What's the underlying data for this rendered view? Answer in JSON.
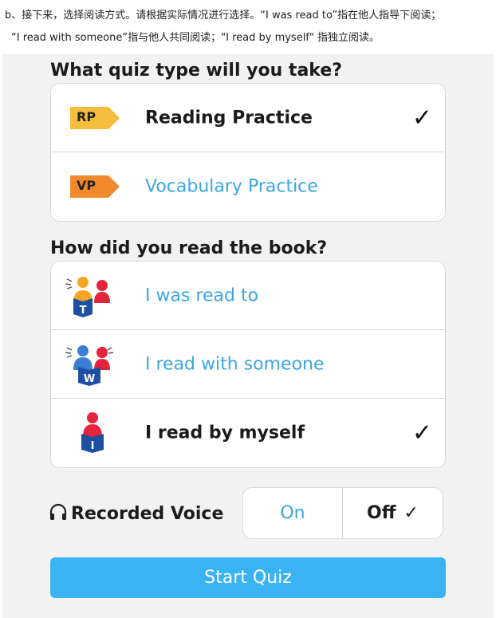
{
  "intro": {
    "line1": "b、接下来，选择阅读方式。请根据实际情况进行选择。“I was read to”指在他人指导下阅读；",
    "line2": "“I read with someone”指与他人共同阅读；\"I read by myself\" 指独立阅读。"
  },
  "quiz": {
    "heading": "What quiz type will you take?",
    "options": [
      {
        "tag": "RP",
        "label": "Reading Practice",
        "selected": true,
        "tag_color": "#f6bd3c"
      },
      {
        "tag": "VP",
        "label": "Vocabulary Practice",
        "selected": false,
        "tag_color": "#f08a2c"
      }
    ]
  },
  "read": {
    "heading": "How did you read the book?",
    "options": [
      {
        "icon": "read-to-icon",
        "letter": "T",
        "label": "I was read to",
        "selected": false
      },
      {
        "icon": "read-with-icon",
        "letter": "W",
        "label": "I read with someone",
        "selected": false
      },
      {
        "icon": "read-independent-icon",
        "letter": "I",
        "label": "I read by myself",
        "selected": true
      }
    ]
  },
  "voice": {
    "label": "Recorded Voice",
    "on_label": "On",
    "off_label": "Off",
    "selected": "Off"
  },
  "start_label": "Start Quiz",
  "check_mark": "✓",
  "colors": {
    "accent": "#3ab3f3",
    "link": "#3aa7e0",
    "figure_red": "#e5233a",
    "figure_blue": "#1d4fa3"
  }
}
